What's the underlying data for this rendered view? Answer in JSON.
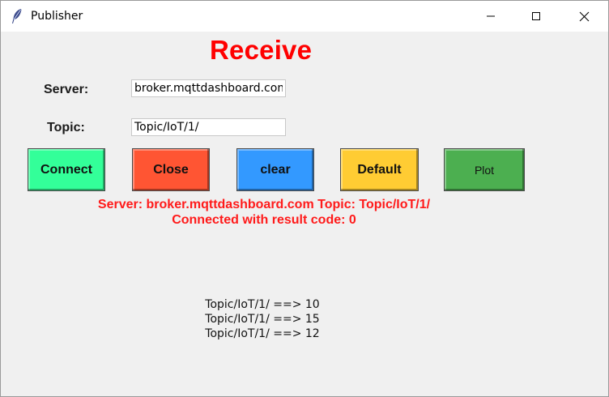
{
  "window": {
    "title": "Publisher",
    "icon": "feather-icon"
  },
  "heading": "Receive",
  "form": {
    "server_label": "Server:",
    "server_value": "broker.mqttdashboard.com",
    "topic_label": "Topic:",
    "topic_value": "Topic/IoT/1/"
  },
  "buttons": {
    "connect": {
      "label": "Connect",
      "color": "#33ff99"
    },
    "close": {
      "label": "Close",
      "color": "#ff5533"
    },
    "clear": {
      "label": "clear",
      "color": "#3399ff"
    },
    "default": {
      "label": "Default",
      "color": "#ffcc33"
    },
    "plot": {
      "label": "Plot",
      "color": "#4caf50"
    }
  },
  "status": {
    "line1": "Server: broker.mqttdashboard.com Topic: Topic/IoT/1/",
    "line2": "Connected with result code: 0",
    "color": "#ff1a1a"
  },
  "messages": [
    "Topic/IoT/1/ ==> 10",
    "Topic/IoT/1/ ==> 15",
    "Topic/IoT/1/ ==> 12"
  ]
}
